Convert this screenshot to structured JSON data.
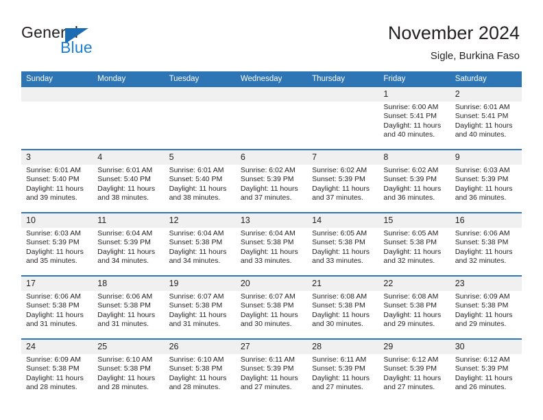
{
  "brand": {
    "name_part1": "General",
    "name_part2": "Blue",
    "flag_color": "#1b6cb3",
    "blue_text_color": "#1c7fd4"
  },
  "header": {
    "title": "November 2024",
    "location": "Sigle, Burkina Faso",
    "header_bg": "#2e75b6",
    "daynum_bg": "#f0f0f0"
  },
  "weekdays": [
    "Sunday",
    "Monday",
    "Tuesday",
    "Wednesday",
    "Thursday",
    "Friday",
    "Saturday"
  ],
  "weeks": [
    [
      {
        "day": "",
        "empty": true
      },
      {
        "day": "",
        "empty": true
      },
      {
        "day": "",
        "empty": true
      },
      {
        "day": "",
        "empty": true
      },
      {
        "day": "",
        "empty": true
      },
      {
        "day": "1",
        "sunrise": "Sunrise: 6:00 AM",
        "sunset": "Sunset: 5:41 PM",
        "daylight1": "Daylight: 11 hours",
        "daylight2": "and 40 minutes."
      },
      {
        "day": "2",
        "sunrise": "Sunrise: 6:01 AM",
        "sunset": "Sunset: 5:41 PM",
        "daylight1": "Daylight: 11 hours",
        "daylight2": "and 40 minutes."
      }
    ],
    [
      {
        "day": "3",
        "sunrise": "Sunrise: 6:01 AM",
        "sunset": "Sunset: 5:40 PM",
        "daylight1": "Daylight: 11 hours",
        "daylight2": "and 39 minutes."
      },
      {
        "day": "4",
        "sunrise": "Sunrise: 6:01 AM",
        "sunset": "Sunset: 5:40 PM",
        "daylight1": "Daylight: 11 hours",
        "daylight2": "and 38 minutes."
      },
      {
        "day": "5",
        "sunrise": "Sunrise: 6:01 AM",
        "sunset": "Sunset: 5:40 PM",
        "daylight1": "Daylight: 11 hours",
        "daylight2": "and 38 minutes."
      },
      {
        "day": "6",
        "sunrise": "Sunrise: 6:02 AM",
        "sunset": "Sunset: 5:39 PM",
        "daylight1": "Daylight: 11 hours",
        "daylight2": "and 37 minutes."
      },
      {
        "day": "7",
        "sunrise": "Sunrise: 6:02 AM",
        "sunset": "Sunset: 5:39 PM",
        "daylight1": "Daylight: 11 hours",
        "daylight2": "and 37 minutes."
      },
      {
        "day": "8",
        "sunrise": "Sunrise: 6:02 AM",
        "sunset": "Sunset: 5:39 PM",
        "daylight1": "Daylight: 11 hours",
        "daylight2": "and 36 minutes."
      },
      {
        "day": "9",
        "sunrise": "Sunrise: 6:03 AM",
        "sunset": "Sunset: 5:39 PM",
        "daylight1": "Daylight: 11 hours",
        "daylight2": "and 36 minutes."
      }
    ],
    [
      {
        "day": "10",
        "sunrise": "Sunrise: 6:03 AM",
        "sunset": "Sunset: 5:39 PM",
        "daylight1": "Daylight: 11 hours",
        "daylight2": "and 35 minutes."
      },
      {
        "day": "11",
        "sunrise": "Sunrise: 6:04 AM",
        "sunset": "Sunset: 5:39 PM",
        "daylight1": "Daylight: 11 hours",
        "daylight2": "and 34 minutes."
      },
      {
        "day": "12",
        "sunrise": "Sunrise: 6:04 AM",
        "sunset": "Sunset: 5:38 PM",
        "daylight1": "Daylight: 11 hours",
        "daylight2": "and 34 minutes."
      },
      {
        "day": "13",
        "sunrise": "Sunrise: 6:04 AM",
        "sunset": "Sunset: 5:38 PM",
        "daylight1": "Daylight: 11 hours",
        "daylight2": "and 33 minutes."
      },
      {
        "day": "14",
        "sunrise": "Sunrise: 6:05 AM",
        "sunset": "Sunset: 5:38 PM",
        "daylight1": "Daylight: 11 hours",
        "daylight2": "and 33 minutes."
      },
      {
        "day": "15",
        "sunrise": "Sunrise: 6:05 AM",
        "sunset": "Sunset: 5:38 PM",
        "daylight1": "Daylight: 11 hours",
        "daylight2": "and 32 minutes."
      },
      {
        "day": "16",
        "sunrise": "Sunrise: 6:06 AM",
        "sunset": "Sunset: 5:38 PM",
        "daylight1": "Daylight: 11 hours",
        "daylight2": "and 32 minutes."
      }
    ],
    [
      {
        "day": "17",
        "sunrise": "Sunrise: 6:06 AM",
        "sunset": "Sunset: 5:38 PM",
        "daylight1": "Daylight: 11 hours",
        "daylight2": "and 31 minutes."
      },
      {
        "day": "18",
        "sunrise": "Sunrise: 6:06 AM",
        "sunset": "Sunset: 5:38 PM",
        "daylight1": "Daylight: 11 hours",
        "daylight2": "and 31 minutes."
      },
      {
        "day": "19",
        "sunrise": "Sunrise: 6:07 AM",
        "sunset": "Sunset: 5:38 PM",
        "daylight1": "Daylight: 11 hours",
        "daylight2": "and 31 minutes."
      },
      {
        "day": "20",
        "sunrise": "Sunrise: 6:07 AM",
        "sunset": "Sunset: 5:38 PM",
        "daylight1": "Daylight: 11 hours",
        "daylight2": "and 30 minutes."
      },
      {
        "day": "21",
        "sunrise": "Sunrise: 6:08 AM",
        "sunset": "Sunset: 5:38 PM",
        "daylight1": "Daylight: 11 hours",
        "daylight2": "and 30 minutes."
      },
      {
        "day": "22",
        "sunrise": "Sunrise: 6:08 AM",
        "sunset": "Sunset: 5:38 PM",
        "daylight1": "Daylight: 11 hours",
        "daylight2": "and 29 minutes."
      },
      {
        "day": "23",
        "sunrise": "Sunrise: 6:09 AM",
        "sunset": "Sunset: 5:38 PM",
        "daylight1": "Daylight: 11 hours",
        "daylight2": "and 29 minutes."
      }
    ],
    [
      {
        "day": "24",
        "sunrise": "Sunrise: 6:09 AM",
        "sunset": "Sunset: 5:38 PM",
        "daylight1": "Daylight: 11 hours",
        "daylight2": "and 28 minutes."
      },
      {
        "day": "25",
        "sunrise": "Sunrise: 6:10 AM",
        "sunset": "Sunset: 5:38 PM",
        "daylight1": "Daylight: 11 hours",
        "daylight2": "and 28 minutes."
      },
      {
        "day": "26",
        "sunrise": "Sunrise: 6:10 AM",
        "sunset": "Sunset: 5:38 PM",
        "daylight1": "Daylight: 11 hours",
        "daylight2": "and 28 minutes."
      },
      {
        "day": "27",
        "sunrise": "Sunrise: 6:11 AM",
        "sunset": "Sunset: 5:39 PM",
        "daylight1": "Daylight: 11 hours",
        "daylight2": "and 27 minutes."
      },
      {
        "day": "28",
        "sunrise": "Sunrise: 6:11 AM",
        "sunset": "Sunset: 5:39 PM",
        "daylight1": "Daylight: 11 hours",
        "daylight2": "and 27 minutes."
      },
      {
        "day": "29",
        "sunrise": "Sunrise: 6:12 AM",
        "sunset": "Sunset: 5:39 PM",
        "daylight1": "Daylight: 11 hours",
        "daylight2": "and 27 minutes."
      },
      {
        "day": "30",
        "sunrise": "Sunrise: 6:12 AM",
        "sunset": "Sunset: 5:39 PM",
        "daylight1": "Daylight: 11 hours",
        "daylight2": "and 26 minutes."
      }
    ]
  ]
}
